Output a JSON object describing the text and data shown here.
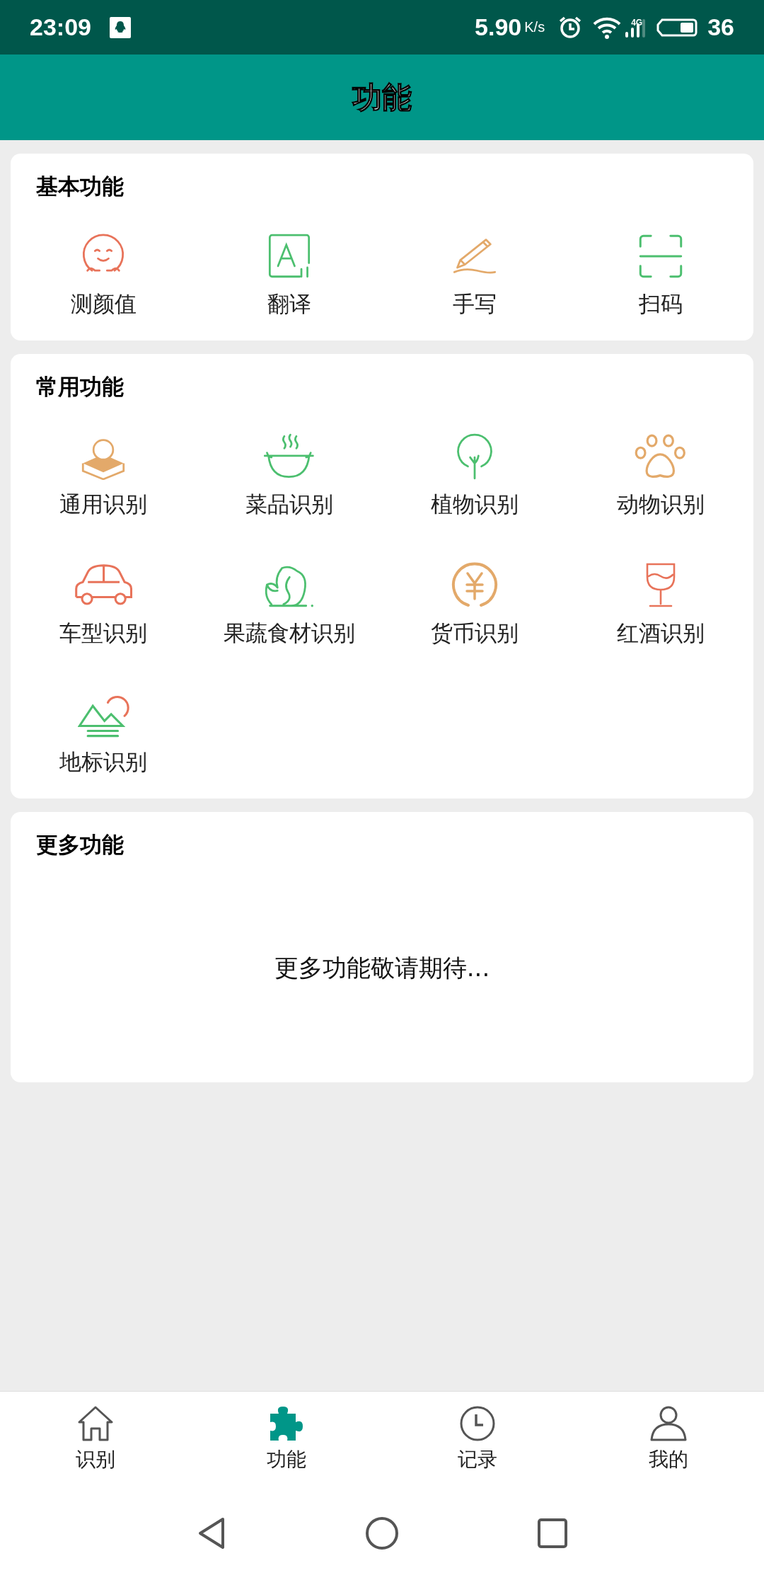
{
  "status_bar": {
    "time": "23:09",
    "speed": "5.90",
    "speed_unit": "K/s",
    "network": "4G",
    "battery": "36"
  },
  "title_bar": {
    "title": "功能"
  },
  "sections": [
    {
      "title": "基本功能",
      "items": [
        {
          "label": "测颜值",
          "kind": "face"
        },
        {
          "label": "翻译",
          "kind": "translate"
        },
        {
          "label": "手写",
          "kind": "pen"
        },
        {
          "label": "扫码",
          "kind": "scan"
        }
      ]
    },
    {
      "title": "常用功能",
      "items": [
        {
          "label": "通用识别",
          "kind": "general"
        },
        {
          "label": "菜品识别",
          "kind": "bowl"
        },
        {
          "label": "植物识别",
          "kind": "plant"
        },
        {
          "label": "动物识别",
          "kind": "paw"
        },
        {
          "label": "车型识别",
          "kind": "car"
        },
        {
          "label": "果蔬食材识别",
          "kind": "vegetable"
        },
        {
          "label": "货币识别",
          "kind": "currency"
        },
        {
          "label": "红酒识别",
          "kind": "wine"
        },
        {
          "label": "地标识别",
          "kind": "landmark"
        }
      ]
    },
    {
      "title": "更多功能",
      "message": "更多功能敬请期待..."
    }
  ],
  "bottom_nav": [
    {
      "label": "识别",
      "kind": "home",
      "selected": false
    },
    {
      "label": "功能",
      "kind": "puzzle",
      "selected": true
    },
    {
      "label": "记录",
      "kind": "clock",
      "selected": false
    },
    {
      "label": "我的",
      "kind": "person",
      "selected": false
    }
  ]
}
